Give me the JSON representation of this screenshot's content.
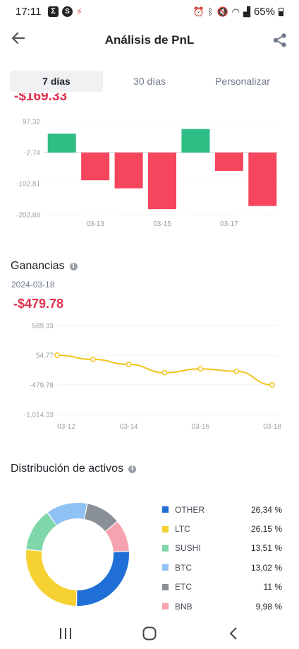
{
  "status_bar": {
    "time": "17:11",
    "battery": "65%",
    "left_icons": [
      "sigma-app-icon",
      "s-app-icon",
      "red-app-icon"
    ],
    "right_icons": [
      "alarm-icon",
      "bluetooth-icon",
      "mute-icon",
      "wifi-icon",
      "signal-icon",
      "battery-icon"
    ]
  },
  "header": {
    "title": "Análisis de PnL",
    "back_icon": "arrow-left-icon",
    "share_icon": "share-icon"
  },
  "tabs": [
    {
      "label": "7 días",
      "active": true
    },
    {
      "label": "30 días",
      "active": false
    },
    {
      "label": "Personalizar",
      "active": false
    }
  ],
  "daily_pnl": {
    "cut_value": "-$169.33"
  },
  "ganancias": {
    "title": "Ganancias",
    "date": "2024-03-18",
    "value": "-$479.78"
  },
  "distribucion": {
    "title": "Distribución de activos"
  },
  "colors": {
    "positive": "#2ebd85",
    "negative": "#f6465d",
    "line": "#f0c419",
    "accent_red": "#e0304e"
  },
  "chart_data": [
    {
      "type": "bar",
      "categories": [
        "03-12",
        "03-13",
        "03-14",
        "03-15",
        "03-16",
        "03-17",
        "03-18"
      ],
      "x_tick_labels": [
        "03-13",
        "03-15",
        "03-17"
      ],
      "y_tick_labels": [
        "97.32",
        "-2.74",
        "-102.81",
        "-202.88"
      ],
      "values": [
        58,
        -92,
        -118,
        -185,
        73,
        -62,
        -175
      ],
      "ylim": [
        -202.88,
        97.32
      ],
      "grid": true
    },
    {
      "type": "line",
      "x": [
        "03-12",
        "03-13",
        "03-14",
        "03-15",
        "03-16",
        "03-17",
        "03-18"
      ],
      "x_tick_labels": [
        "03-12",
        "03-14",
        "03-16",
        "03-18"
      ],
      "y_tick_labels": [
        "589.33",
        "54.77",
        "-479.78",
        "-1,014.33"
      ],
      "values": [
        54.77,
        -20,
        -110,
        -260,
        -190,
        -235,
        -479.78
      ],
      "ylim": [
        -1014.33,
        589.33
      ],
      "grid": true
    },
    {
      "type": "pie",
      "labels": [
        "OTHER",
        "LTC",
        "SUSHI",
        "BTC",
        "ETC",
        "BNB"
      ],
      "values": [
        26.34,
        26.15,
        13.51,
        13.02,
        11,
        9.98
      ],
      "display": [
        "26,34 %",
        "26,15 %",
        "13,51 %",
        "13,02 %",
        "11 %",
        "9,98 %"
      ],
      "colors": [
        "#1f6fd6",
        "#f5d132",
        "#7fd6a9",
        "#8fc3f5",
        "#8a9098",
        "#f5a3ae"
      ]
    }
  ],
  "nav_bar": {
    "icons": [
      "recent-apps-icon",
      "home-icon",
      "back-icon"
    ]
  }
}
